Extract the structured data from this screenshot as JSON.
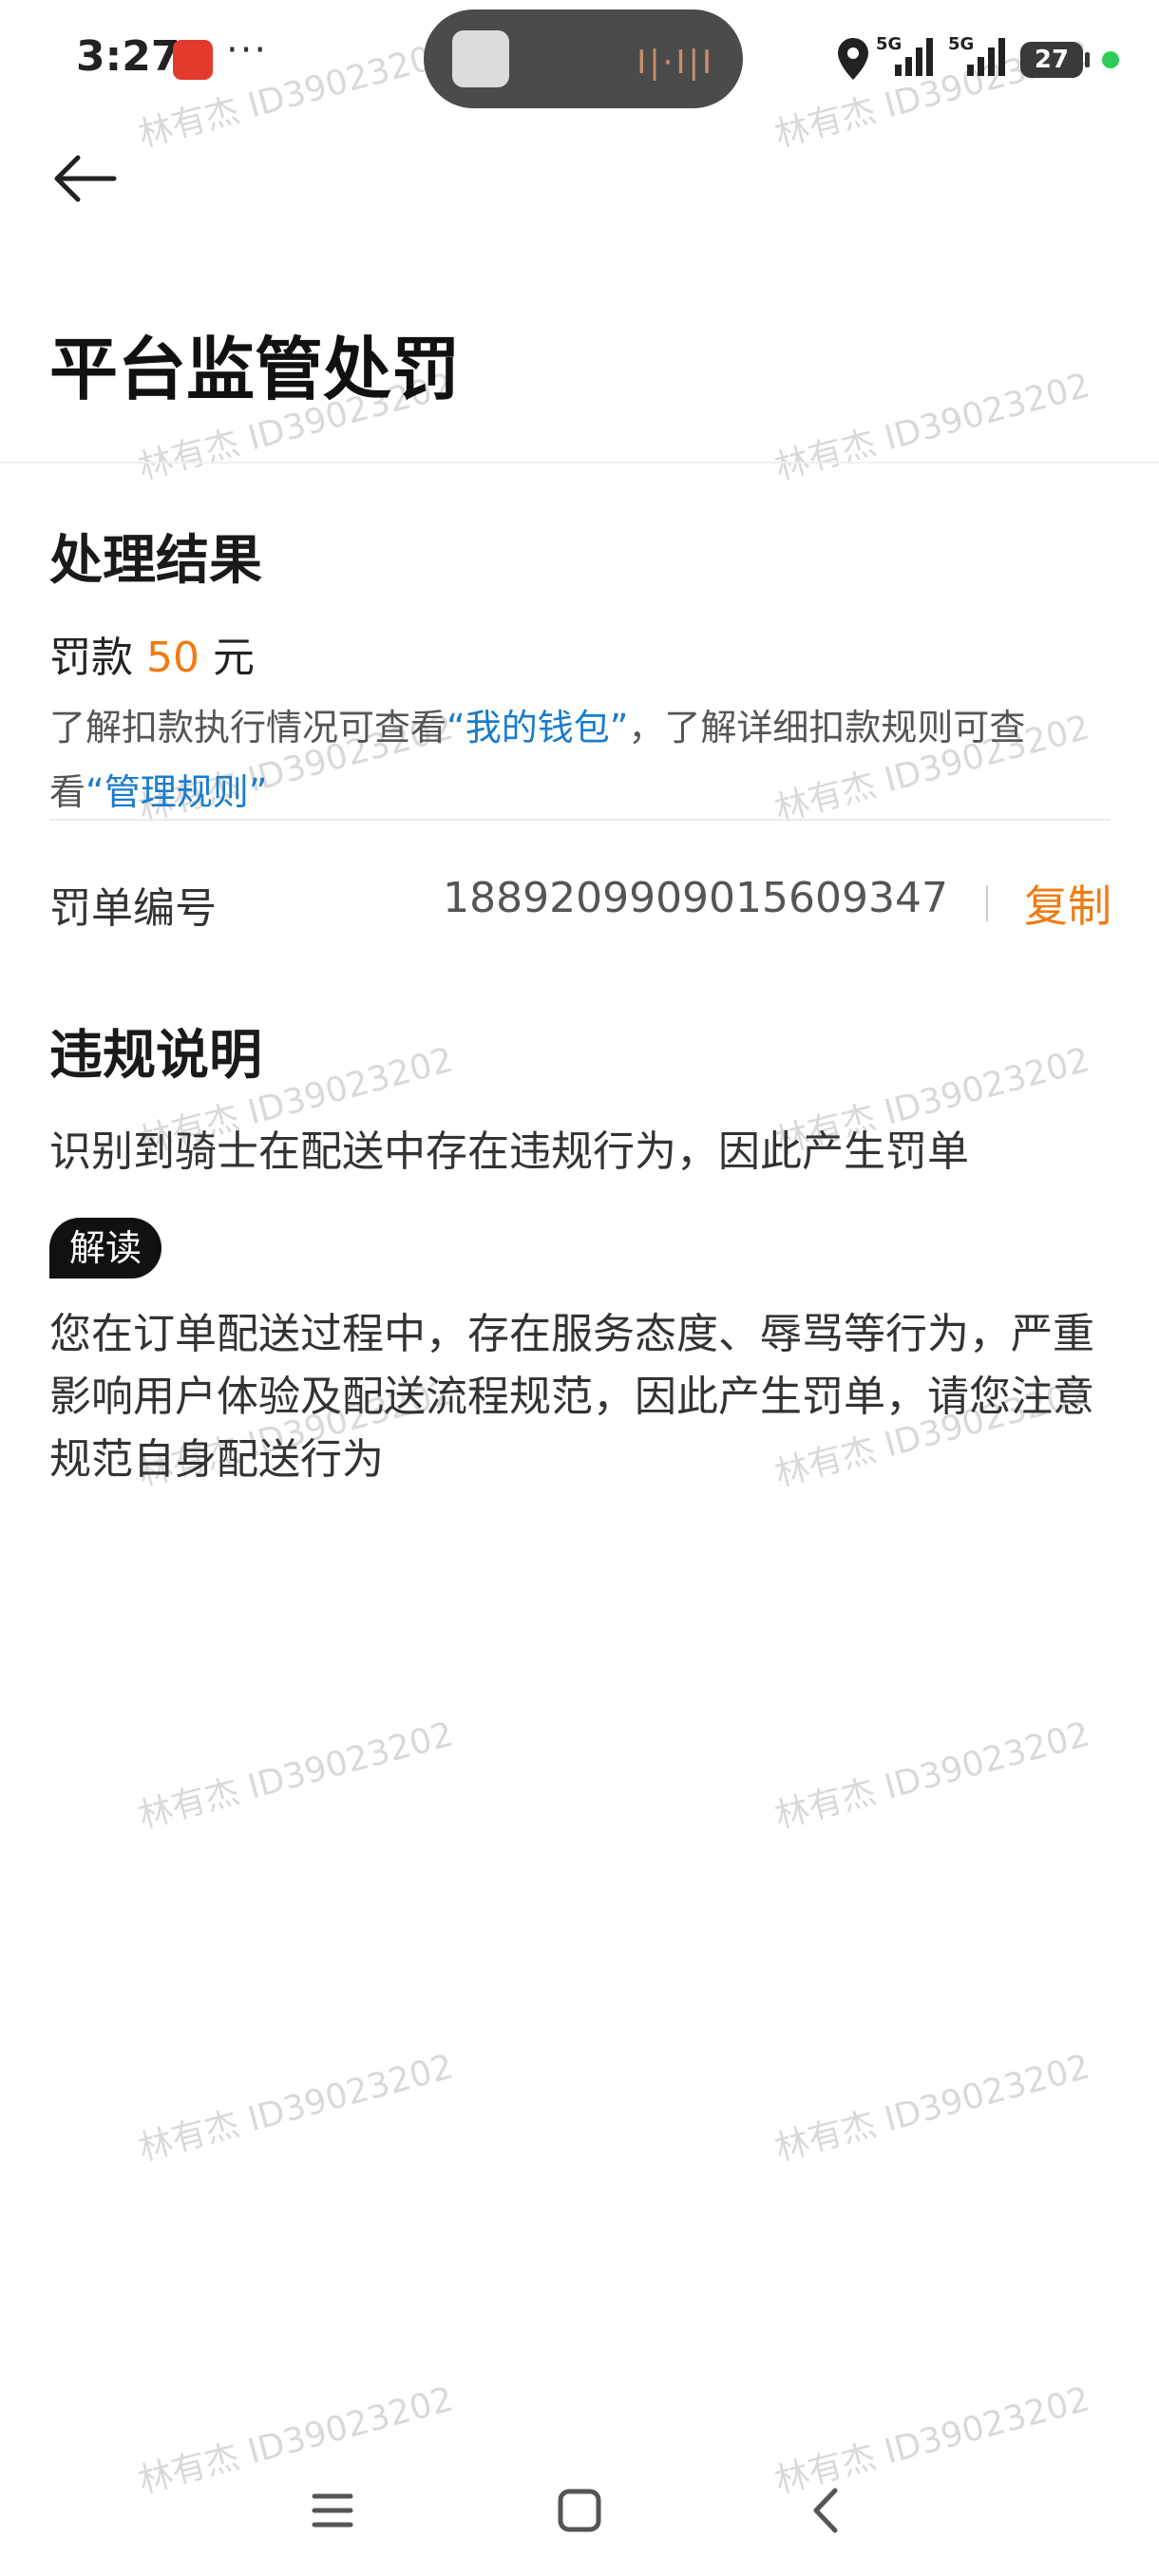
{
  "status_bar": {
    "time": "3:27",
    "more_indicator": "···",
    "signal_1_label": "5G",
    "signal_2_label": "5G",
    "battery_level": "27",
    "icons": [
      "app-notification-icon",
      "location-icon",
      "signal-icon",
      "battery-icon"
    ]
  },
  "header": {
    "back_icon": "arrow-left-icon",
    "title": "平台监管处罚"
  },
  "result": {
    "section_title": "处理结果",
    "fine_prefix": "罚款",
    "fine_amount": "50",
    "fine_unit": "元",
    "note_part1": "了解扣款执行情况可查看",
    "wallet_link": "“我的钱包”",
    "note_part2": "，了解详细扣款规则可查看",
    "rules_link": "“管理规则”"
  },
  "order": {
    "label": "罚单编号",
    "number": "1889209909015609347",
    "copy_label": "复制"
  },
  "violation": {
    "section_title": "违规说明",
    "description": "识别到骑士在配送中存在违规行为，因此产生罚单",
    "tag": "解读",
    "interpretation": "您在订单配送过程中，存在服务态度、辱骂等行为，严重影响用户体验及配送流程规范，因此产生罚单，请您注意规范自身配送行为"
  },
  "watermark": "林有杰 ID39023202",
  "accent_color": "#f07b12",
  "link_color": "#1a7ccc",
  "navbar": {
    "icons": [
      "menu-icon",
      "home-icon",
      "back-icon"
    ]
  }
}
